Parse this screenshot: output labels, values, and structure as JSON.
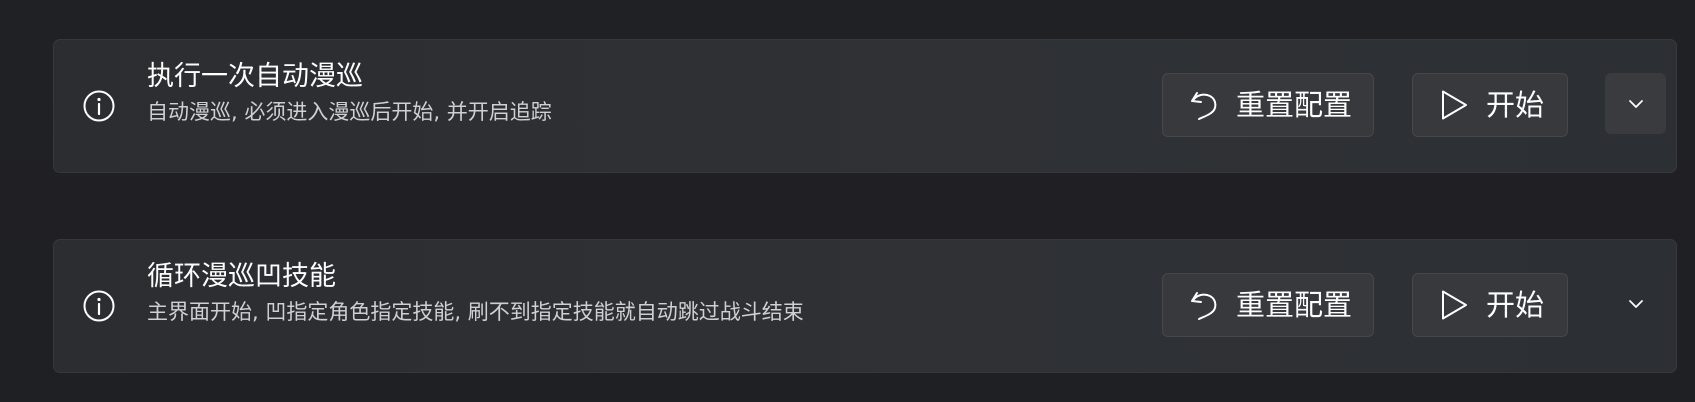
{
  "tasks": [
    {
      "title": "执行一次自动漫巡",
      "description": "自动漫巡, 必须进入漫巡后开始, 并开启追踪",
      "reset_label": "重置配置",
      "start_label": "开始",
      "info_icon": "info-icon",
      "reset_icon": "undo-icon",
      "start_icon": "play-icon",
      "expand_icon": "chevron-down-icon"
    },
    {
      "title": "循环漫巡凹技能",
      "description": "主界面开始, 凹指定角色指定技能, 刷不到指定技能就自动跳过战斗结束",
      "reset_label": "重置配置",
      "start_label": "开始",
      "info_icon": "info-icon",
      "reset_icon": "undo-icon",
      "start_icon": "play-icon",
      "expand_icon": "chevron-down-icon"
    }
  ],
  "colors": {
    "background": "#202124",
    "card": "#2e3034",
    "button": "#37393d",
    "text_primary": "#ffffff",
    "text_secondary": "#cfd0d2"
  }
}
